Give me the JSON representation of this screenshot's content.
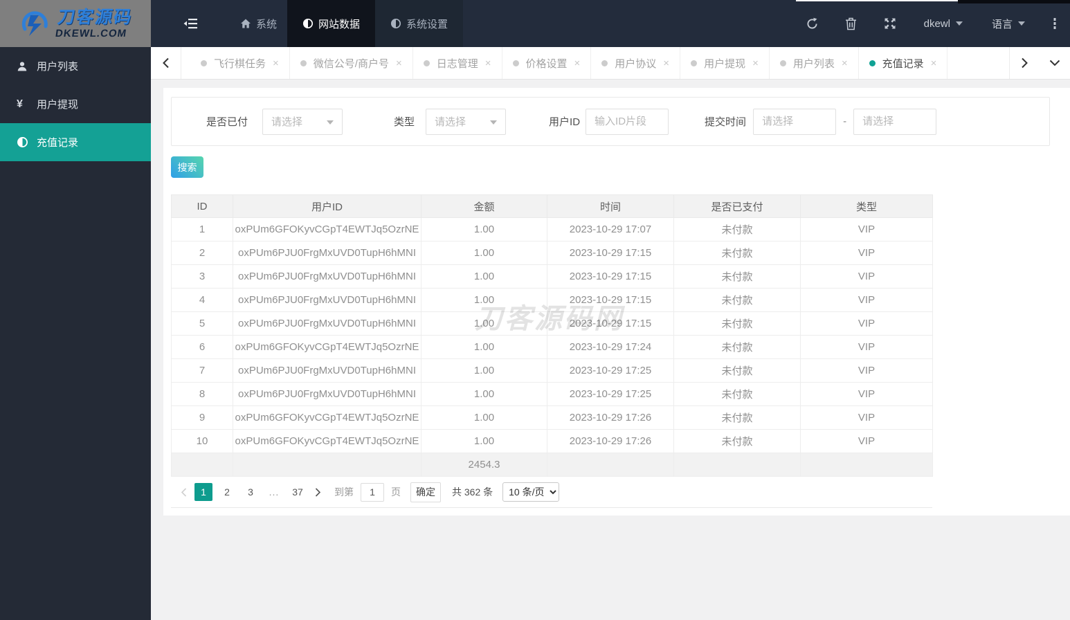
{
  "topbar": {
    "logo_title": "刀客源码",
    "logo_subtitle": "DKEWL.COM",
    "nav": [
      {
        "label": "系统",
        "icon": "home-icon"
      },
      {
        "label": "网站数据",
        "icon": "half-circle-icon",
        "active": true
      },
      {
        "label": "系统设置",
        "icon": "half-circle-icon"
      }
    ],
    "username": "dkewl",
    "language_label": "语言"
  },
  "tabbar": {
    "tabs": [
      {
        "label": "飞行棋任务"
      },
      {
        "label": "微信公号/商户号"
      },
      {
        "label": "日志管理"
      },
      {
        "label": "价格设置"
      },
      {
        "label": "用户协议"
      },
      {
        "label": "用户提现"
      },
      {
        "label": "用户列表"
      },
      {
        "label": "充值记录",
        "active": true
      }
    ],
    "close_glyph": "×"
  },
  "sidebar": {
    "items": [
      {
        "label": "用户列表"
      },
      {
        "label": "用户提现"
      },
      {
        "label": "充值记录",
        "active": true
      }
    ]
  },
  "filters": {
    "paid_label": "是否已付",
    "paid_placeholder": "请选择",
    "type_label": "类型",
    "type_placeholder": "请选择",
    "userid_label": "用户ID",
    "userid_placeholder": "输入ID片段",
    "time_label": "提交时间",
    "time_from_placeholder": "请选择",
    "time_to_placeholder": "请选择",
    "range_separator": "-",
    "search_label": "搜索"
  },
  "table": {
    "columns": [
      "ID",
      "用户ID",
      "金额",
      "时间",
      "是否已支付",
      "类型"
    ],
    "rows": [
      [
        "1",
        "oxPUm6GFOKyvCGpT4EWTJq5OzrNE",
        "1.00",
        "2023-10-29 17:07",
        "未付款",
        "VIP"
      ],
      [
        "2",
        "oxPUm6PJU0FrgMxUVD0TupH6hMNI",
        "1.00",
        "2023-10-29 17:15",
        "未付款",
        "VIP"
      ],
      [
        "3",
        "oxPUm6PJU0FrgMxUVD0TupH6hMNI",
        "1.00",
        "2023-10-29 17:15",
        "未付款",
        "VIP"
      ],
      [
        "4",
        "oxPUm6PJU0FrgMxUVD0TupH6hMNI",
        "1.00",
        "2023-10-29 17:15",
        "未付款",
        "VIP"
      ],
      [
        "5",
        "oxPUm6PJU0FrgMxUVD0TupH6hMNI",
        "1.00",
        "2023-10-29 17:15",
        "未付款",
        "VIP"
      ],
      [
        "6",
        "oxPUm6GFOKyvCGpT4EWTJq5OzrNE",
        "1.00",
        "2023-10-29 17:24",
        "未付款",
        "VIP"
      ],
      [
        "7",
        "oxPUm6PJU0FrgMxUVD0TupH6hMNI",
        "1.00",
        "2023-10-29 17:25",
        "未付款",
        "VIP"
      ],
      [
        "8",
        "oxPUm6PJU0FrgMxUVD0TupH6hMNI",
        "1.00",
        "2023-10-29 17:25",
        "未付款",
        "VIP"
      ],
      [
        "9",
        "oxPUm6GFOKyvCGpT4EWTJq5OzrNE",
        "1.00",
        "2023-10-29 17:26",
        "未付款",
        "VIP"
      ],
      [
        "10",
        "oxPUm6GFOKyvCGpT4EWTJq5OzrNE",
        "1.00",
        "2023-10-29 17:26",
        "未付款",
        "VIP"
      ]
    ],
    "summary_amount": "2454.3"
  },
  "pagination": {
    "pages": [
      {
        "label": "1",
        "active": true
      },
      {
        "label": "2"
      },
      {
        "label": "3"
      },
      {
        "label": "...",
        "cls": "ellipsis"
      },
      {
        "label": "37"
      }
    ],
    "goto_label": "到第",
    "goto_value": "1",
    "page_unit": "页",
    "confirm_label": "确定",
    "total_text": "共 362 条",
    "page_size": "10 条/页"
  },
  "watermark": "刀客源码网",
  "colors": {
    "accent_teal": "#10a294",
    "sidebar_active": "#14a195",
    "navbar_bg": "#232c3c",
    "nav_active_bg": "#10141c",
    "search_gradient_from": "#57d5ae",
    "search_gradient_to": "#2f9fe8",
    "table_header_bg": "#f2f2f2"
  }
}
